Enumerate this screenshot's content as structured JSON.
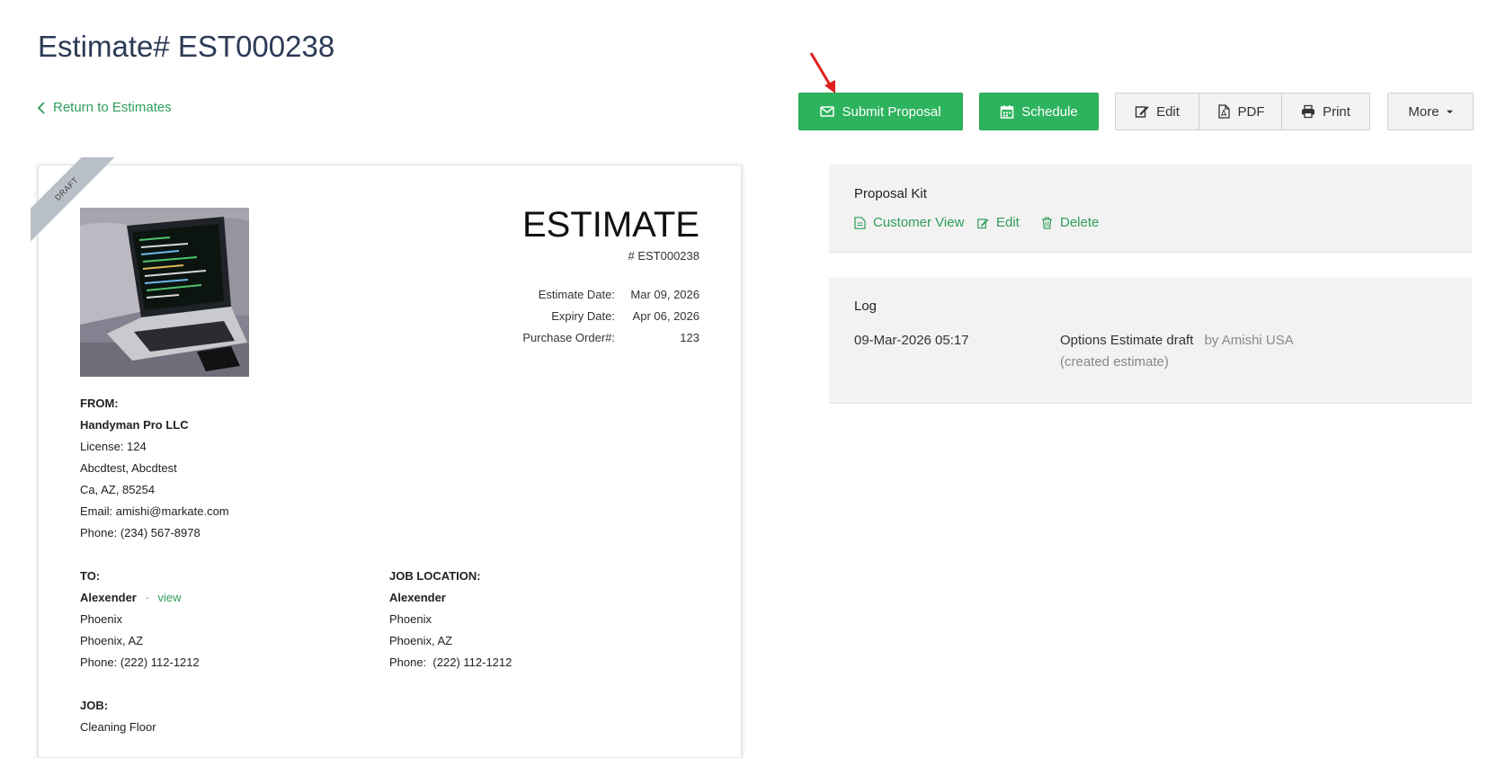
{
  "page": {
    "title": "Estimate# EST000238",
    "return_link": "Return to Estimates"
  },
  "toolbar": {
    "submit_proposal": "Submit Proposal",
    "schedule": "Schedule",
    "edit": "Edit",
    "pdf": "PDF",
    "print": "Print",
    "more": "More",
    "accent_color": "#2db35d"
  },
  "document": {
    "ribbon": "DRAFT",
    "heading": "ESTIMATE",
    "number": "# EST000238",
    "meta": [
      {
        "label": "Estimate Date:",
        "value": "Mar 09, 2026"
      },
      {
        "label": "Expiry Date:",
        "value": "Apr 06, 2026"
      },
      {
        "label": "Purchase Order#:",
        "value": "123"
      }
    ],
    "from": {
      "heading": "FROM:",
      "company": "Handyman Pro LLC",
      "license": "License: 124",
      "address1": "Abcdtest, Abcdtest",
      "address2": "Ca, AZ, 85254",
      "email": "Email: amishi@markate.com",
      "phone": "Phone: (234) 567-8978"
    },
    "to": {
      "heading": "TO:",
      "name": "Alexender",
      "separator": "·",
      "view_link": "view",
      "city": "Phoenix",
      "state": "Phoenix, AZ",
      "phone": "Phone: (222) 112-1212"
    },
    "job_location": {
      "heading": "JOB LOCATION:",
      "name": "Alexender",
      "city": "Phoenix",
      "state": "Phoenix, AZ",
      "phone": "Phone:  (222) 112-1212"
    },
    "job": {
      "heading": "JOB:",
      "name": "Cleaning Floor"
    }
  },
  "proposal_kit": {
    "title": "Proposal Kit",
    "customer_view": "Customer View",
    "edit": "Edit",
    "delete": "Delete"
  },
  "log": {
    "title": "Log",
    "entries": [
      {
        "timestamp": "09-Mar-2026 05:17",
        "message": "Options Estimate draft",
        "author": "by Amishi USA",
        "detail": "(created estimate)"
      }
    ]
  }
}
